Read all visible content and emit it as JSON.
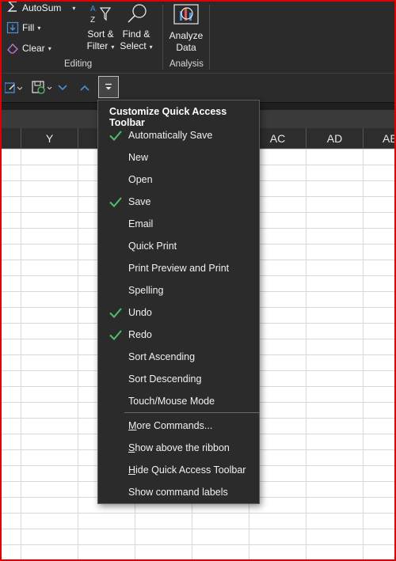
{
  "ribbon": {
    "autosum": "AutoSum",
    "fill": "Fill",
    "clear": "Clear",
    "sort_filter_line1": "Sort &",
    "sort_filter_line2": "Filter",
    "find_select_line1": "Find &",
    "find_select_line2": "Select",
    "analyze_line1": "Analyze",
    "analyze_line2": "Data",
    "group_editing": "Editing",
    "group_analysis": "Analysis"
  },
  "columns": [
    "Y",
    "AC",
    "AD",
    "AE"
  ],
  "menu": {
    "title": "Customize Quick Access Toolbar",
    "items": [
      {
        "label": "Automatically Save",
        "checked": true
      },
      {
        "label": "New",
        "checked": false
      },
      {
        "label": "Open",
        "checked": false
      },
      {
        "label": "Save",
        "checked": true
      },
      {
        "label": "Email",
        "checked": false
      },
      {
        "label": "Quick Print",
        "checked": false
      },
      {
        "label": "Print Preview and Print",
        "checked": false
      },
      {
        "label": "Spelling",
        "checked": false
      },
      {
        "label": "Undo",
        "checked": true
      },
      {
        "label": "Redo",
        "checked": true
      },
      {
        "label": "Sort Ascending",
        "checked": false
      },
      {
        "label": "Sort Descending",
        "checked": false
      },
      {
        "label": "Touch/Mouse Mode",
        "checked": false
      }
    ],
    "commands": [
      {
        "accel": "M",
        "rest": "ore Commands..."
      },
      {
        "accel": "S",
        "rest": "how above the ribbon"
      },
      {
        "accel": "H",
        "rest": "ide Quick Access Toolbar"
      },
      {
        "accel": "",
        "rest": "Show command labels"
      }
    ]
  },
  "colors": {
    "ribbon_bg": "#2b2b2b",
    "menu_bg": "#2b2b2b",
    "check_green": "#4fbf6a",
    "frame_border": "#e00000"
  }
}
